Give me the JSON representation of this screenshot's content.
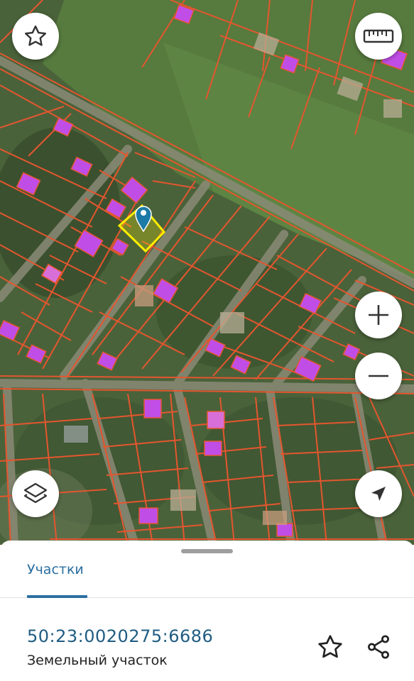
{
  "map": {
    "layer_name": "satellite-cadastral",
    "buttons": {
      "favorite_icon": "star-outline-icon",
      "ruler_icon": "ruler-icon",
      "zoom_in_icon": "plus-icon",
      "zoom_out_icon": "minus-icon",
      "layers_icon": "layers-icon",
      "locate_icon": "navigation-arrow-icon"
    },
    "colors": {
      "boundary": "#e4562f",
      "building": "#c04ee6",
      "selected_parcel": "#ffee00",
      "marker": "#1c7aa6"
    }
  },
  "sheet": {
    "tab_label": "Участки",
    "cadastral_number": "50:23:0020275:6686",
    "parcel_type": "Земельный участок",
    "actions": {
      "favorite_icon": "star-outline-icon",
      "share_icon": "share-icon"
    },
    "accent_color": "#2b6fa0"
  }
}
